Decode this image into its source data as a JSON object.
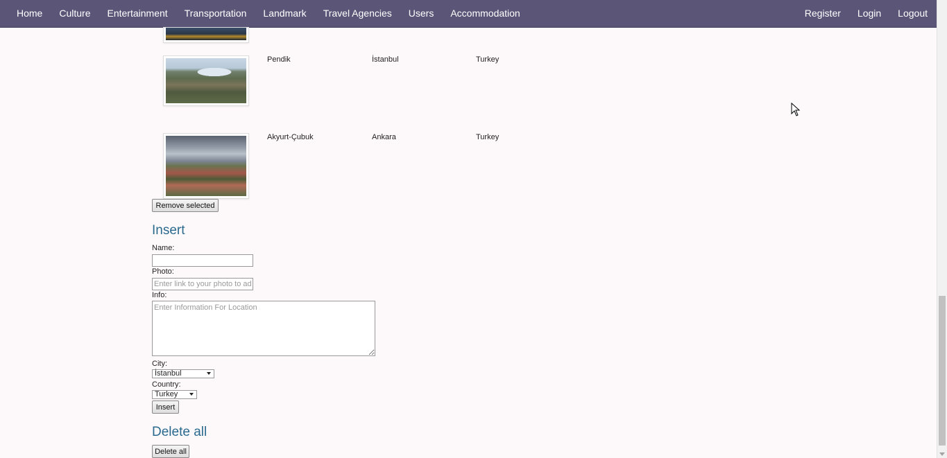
{
  "nav": {
    "left": [
      "Home",
      "Culture",
      "Entertainment",
      "Transportation",
      "Landmark",
      "Travel Agencies",
      "Users",
      "Accommodation"
    ],
    "right": [
      "Register",
      "Login",
      "Logout"
    ]
  },
  "locations": [
    {
      "name": "Pendik",
      "city": "İstanbul",
      "country": "Turkey"
    },
    {
      "name": "Akyurt-Çubuk",
      "city": "Ankara",
      "country": "Turkey"
    }
  ],
  "remove_button": "Remove selected",
  "insert": {
    "heading": "Insert",
    "name_label": "Name:",
    "name_value": "",
    "photo_label": "Photo:",
    "photo_placeholder": "Enter link to your photo to add",
    "info_label": "Info:",
    "info_placeholder": "Enter Information For Location",
    "city_label": "City:",
    "city_value": "İstanbul",
    "country_label": "Country:",
    "country_value": "Turkey",
    "submit": "Insert"
  },
  "delete_all": {
    "heading": "Delete all",
    "button": "Delete all"
  }
}
